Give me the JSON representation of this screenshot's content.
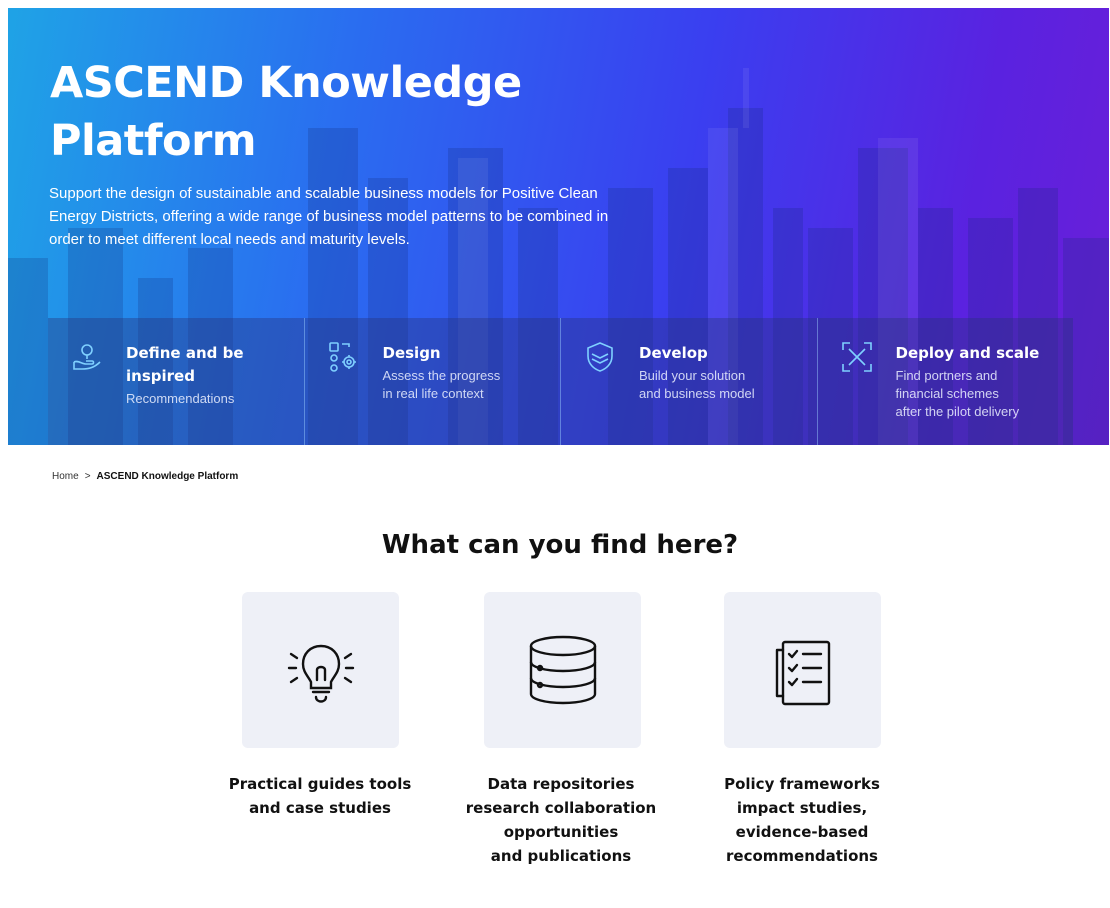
{
  "hero": {
    "title": "ASCEND Knowledge Platform",
    "description": "Support the design of sustainable and scalable business models for Positive Clean Energy Districts, offering a wide range of business model patterns to be combined in order to meet different local needs and maturity levels.",
    "features": [
      {
        "icon": "hand-person-icon",
        "title": "Define and be inspired",
        "description": "Recommendations"
      },
      {
        "icon": "design-gear-icon",
        "title": "Design",
        "description": "Assess the progress\nin real life context"
      },
      {
        "icon": "layers-shield-icon",
        "title": "Develop",
        "description": "Build your solution\nand business model"
      },
      {
        "icon": "expand-arrows-icon",
        "title": "Deploy and scale",
        "description": "Find portners and\nfinancial schemes\nafter the pilot delivery"
      }
    ]
  },
  "breadcrumb": {
    "home": "Home",
    "separator": ">",
    "current": "ASCEND Knowledge Platform"
  },
  "section": {
    "title": "What can you find here?",
    "cards": [
      {
        "icon": "lightbulb-icon",
        "label": "Practical guides tools\nand case studies"
      },
      {
        "icon": "database-icon",
        "label": "Data repositories\nresearch collaboration\nopportunities\nand publications"
      },
      {
        "icon": "checklist-icon",
        "label": "Policy frameworks\nimpact studies,\nevidence-based\nrecommendations"
      }
    ]
  },
  "colors": {
    "gradient_start": "#1fa3e6",
    "gradient_end": "#6a1fd8",
    "card_background": "#eef0f7",
    "icon_accent": "#7fd0ff"
  }
}
